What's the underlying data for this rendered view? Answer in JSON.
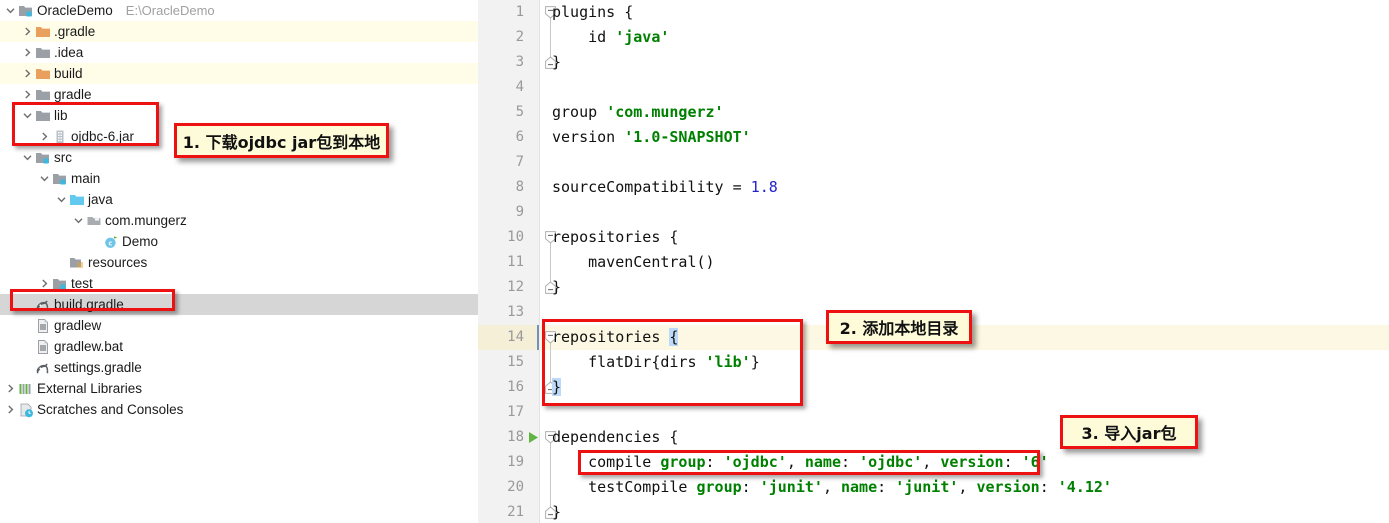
{
  "colors": {
    "annotation_border": "#ee1111",
    "annotation_fill": "#fdfbd8",
    "string_green": "#008000",
    "number_blue": "#2222cc",
    "excluded_row": "#fffde7",
    "selected_row": "#d6d6d6",
    "caret_line": "#fdf8e3",
    "brace_match": "#bcd9f7"
  },
  "project_tree": {
    "root": {
      "label": "OracleDemo",
      "path": "E:\\OracleDemo",
      "icon": "module-folder-icon",
      "expanded": true
    },
    "items": [
      {
        "label": ".gradle",
        "icon": "folder-excluded-icon",
        "indent": 1,
        "twisty": "collapsed",
        "state": "excluded"
      },
      {
        "label": ".idea",
        "icon": "folder-icon",
        "indent": 1,
        "twisty": "collapsed",
        "state": "normal"
      },
      {
        "label": "build",
        "icon": "folder-excluded-icon",
        "indent": 1,
        "twisty": "collapsed",
        "state": "excluded"
      },
      {
        "label": "gradle",
        "icon": "folder-icon",
        "indent": 1,
        "twisty": "collapsed",
        "state": "normal"
      },
      {
        "label": "lib",
        "icon": "folder-icon",
        "indent": 1,
        "twisty": "expanded",
        "state": "normal"
      },
      {
        "label": "ojdbc-6.jar",
        "icon": "jar-file-icon",
        "indent": 2,
        "twisty": "collapsed",
        "state": "normal"
      },
      {
        "label": "src",
        "icon": "source-folder-icon",
        "indent": 1,
        "twisty": "expanded",
        "state": "normal"
      },
      {
        "label": "main",
        "icon": "source-folder-icon",
        "indent": 2,
        "twisty": "expanded",
        "state": "normal"
      },
      {
        "label": "java",
        "icon": "sources-root-icon",
        "indent": 3,
        "twisty": "expanded",
        "state": "normal"
      },
      {
        "label": "com.mungerz",
        "icon": "package-icon",
        "indent": 4,
        "twisty": "expanded",
        "state": "normal"
      },
      {
        "label": "Demo",
        "icon": "java-class-icon",
        "indent": 5,
        "twisty": "none",
        "state": "normal"
      },
      {
        "label": "resources",
        "icon": "resources-folder-icon",
        "indent": 3,
        "twisty": "none",
        "state": "normal"
      },
      {
        "label": "test",
        "icon": "source-folder-icon",
        "indent": 2,
        "twisty": "collapsed",
        "state": "normal"
      },
      {
        "label": "build.gradle",
        "icon": "gradle-file-icon",
        "indent": 1,
        "twisty": "none",
        "state": "selected"
      },
      {
        "label": "gradlew",
        "icon": "text-file-icon",
        "indent": 1,
        "twisty": "none",
        "state": "normal"
      },
      {
        "label": "gradlew.bat",
        "icon": "text-file-icon",
        "indent": 1,
        "twisty": "none",
        "state": "normal"
      },
      {
        "label": "settings.gradle",
        "icon": "gradle-file-icon",
        "indent": 1,
        "twisty": "none",
        "state": "normal"
      },
      {
        "label": "External Libraries",
        "icon": "external-libraries-icon",
        "indent": 0,
        "twisty": "collapsed",
        "state": "normal"
      },
      {
        "label": "Scratches and Consoles",
        "icon": "scratches-icon",
        "indent": 0,
        "twisty": "collapsed",
        "state": "normal"
      }
    ]
  },
  "editor": {
    "filename": "build.gradle",
    "caret_line": 14,
    "run_gutter_line": 18,
    "lines": [
      {
        "n": "1",
        "indent": 0,
        "fold": "open",
        "text": "plugins {"
      },
      {
        "n": "2",
        "indent": 0,
        "fold": "",
        "text": "    id 'java'"
      },
      {
        "n": "3",
        "indent": 0,
        "fold": "close",
        "text": "}"
      },
      {
        "n": "4",
        "indent": 0,
        "fold": "",
        "text": ""
      },
      {
        "n": "5",
        "indent": 0,
        "fold": "",
        "text": "group 'com.mungerz'"
      },
      {
        "n": "6",
        "indent": 0,
        "fold": "",
        "text": "version '1.0-SNAPSHOT'"
      },
      {
        "n": "7",
        "indent": 0,
        "fold": "",
        "text": ""
      },
      {
        "n": "8",
        "indent": 0,
        "fold": "",
        "text": "sourceCompatibility = 1.8"
      },
      {
        "n": "9",
        "indent": 0,
        "fold": "",
        "text": ""
      },
      {
        "n": "10",
        "indent": 0,
        "fold": "open",
        "text": "repositories {"
      },
      {
        "n": "11",
        "indent": 0,
        "fold": "",
        "text": "    mavenCentral()"
      },
      {
        "n": "12",
        "indent": 0,
        "fold": "close",
        "text": "}"
      },
      {
        "n": "13",
        "indent": 0,
        "fold": "",
        "text": ""
      },
      {
        "n": "14",
        "indent": 0,
        "fold": "open",
        "text": "repositories {"
      },
      {
        "n": "15",
        "indent": 0,
        "fold": "",
        "text": "    flatDir{dirs 'lib'}"
      },
      {
        "n": "16",
        "indent": 0,
        "fold": "close",
        "text": "}"
      },
      {
        "n": "17",
        "indent": 0,
        "fold": "",
        "text": ""
      },
      {
        "n": "18",
        "indent": 0,
        "fold": "open",
        "text": "dependencies {"
      },
      {
        "n": "19",
        "indent": 0,
        "fold": "",
        "text": "    compile group: 'ojdbc', name: 'ojdbc', version: '6'"
      },
      {
        "n": "20",
        "indent": 0,
        "fold": "",
        "text": "    testCompile group: 'junit', name: 'junit', version: '4.12'"
      },
      {
        "n": "21",
        "indent": 0,
        "fold": "close",
        "text": "}"
      }
    ]
  },
  "annotations": {
    "callouts": [
      {
        "id": "callout-1",
        "text": "1. 下载ojdbc jar包到本地"
      },
      {
        "id": "callout-2",
        "text": "2. 添加本地目录"
      },
      {
        "id": "callout-3",
        "text": "3. 导入jar包"
      }
    ],
    "highlight_boxes": [
      {
        "id": "box-lib-jar",
        "target": "lib / ojdbc-6.jar tree rows"
      },
      {
        "id": "box-build-gradle",
        "target": "build.gradle tree row"
      },
      {
        "id": "box-repositories",
        "target": "repositories flatDir block lines 14-16"
      },
      {
        "id": "box-compile-ojdbc",
        "target": "compile group ojdbc line 19"
      }
    ]
  }
}
